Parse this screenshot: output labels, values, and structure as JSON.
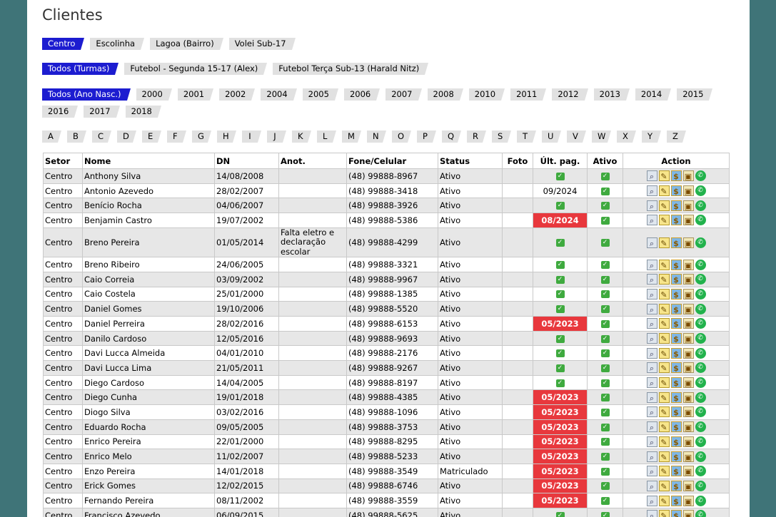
{
  "page_title": "Clientes",
  "setores": [
    {
      "label": "Centro",
      "active": true
    },
    {
      "label": "Escolinha",
      "active": false
    },
    {
      "label": "Lagoa (Bairro)",
      "active": false
    },
    {
      "label": "Volei Sub-17",
      "active": false
    }
  ],
  "turmas": [
    {
      "label": "Todos (Turmas)",
      "active": true
    },
    {
      "label": "Futebol - Segunda 15-17 (Alex)",
      "active": false
    },
    {
      "label": "Futebol Terça Sub-13 (Harald Nitz)",
      "active": false
    }
  ],
  "anos": [
    {
      "label": "Todos (Ano Nasc.)",
      "active": true
    },
    {
      "label": "2000"
    },
    {
      "label": "2001"
    },
    {
      "label": "2002"
    },
    {
      "label": "2004"
    },
    {
      "label": "2005"
    },
    {
      "label": "2006"
    },
    {
      "label": "2007"
    },
    {
      "label": "2008"
    },
    {
      "label": "2010"
    },
    {
      "label": "2011"
    },
    {
      "label": "2012"
    },
    {
      "label": "2013"
    },
    {
      "label": "2014"
    },
    {
      "label": "2015"
    },
    {
      "label": "2016"
    },
    {
      "label": "2017"
    },
    {
      "label": "2018"
    }
  ],
  "letters": [
    "A",
    "B",
    "C",
    "D",
    "E",
    "F",
    "G",
    "H",
    "I",
    "J",
    "K",
    "L",
    "M",
    "N",
    "O",
    "P",
    "Q",
    "R",
    "S",
    "T",
    "U",
    "V",
    "W",
    "X",
    "Y",
    "Z"
  ],
  "table": {
    "headers": [
      "Setor",
      "Nome",
      "DN",
      "Anot.",
      "Fone/Celular",
      "Status",
      "Foto",
      "Últ. pag.",
      "Ativo",
      "Action"
    ],
    "rows": [
      {
        "setor": "Centro",
        "nome": "Anthony Silva",
        "dn": "14/08/2008",
        "anot": "",
        "fone": "(48) 99888-8967",
        "status": "Ativo",
        "ult": "",
        "ult_due": false
      },
      {
        "setor": "Centro",
        "nome": "Antonio Azevedo",
        "dn": "28/02/2007",
        "anot": "",
        "fone": "(48) 99888-3418",
        "status": "Ativo",
        "ult": "09/2024",
        "ult_due": false
      },
      {
        "setor": "Centro",
        "nome": "Benício Rocha",
        "dn": "04/06/2007",
        "anot": "",
        "fone": "(48) 99888-3926",
        "status": "Ativo",
        "ult": "",
        "ult_due": false
      },
      {
        "setor": "Centro",
        "nome": "Benjamin Castro",
        "dn": "19/07/2002",
        "anot": "",
        "fone": "(48) 99888-5386",
        "status": "Ativo",
        "ult": "08/2024",
        "ult_due": true
      },
      {
        "setor": "Centro",
        "nome": "Breno Pereira",
        "dn": "01/05/2014",
        "anot": "Falta eletro e declaração escolar",
        "fone": "(48) 99888-4299",
        "status": "Ativo",
        "ult": "",
        "ult_due": false
      },
      {
        "setor": "Centro",
        "nome": "Breno Ribeiro",
        "dn": "24/06/2005",
        "anot": "",
        "fone": "(48) 99888-3321",
        "status": "Ativo",
        "ult": "",
        "ult_due": false
      },
      {
        "setor": "Centro",
        "nome": "Caio Correia",
        "dn": "03/09/2002",
        "anot": "",
        "fone": "(48) 99888-9967",
        "status": "Ativo",
        "ult": "",
        "ult_due": false
      },
      {
        "setor": "Centro",
        "nome": "Caio Costela",
        "dn": "25/01/2000",
        "anot": "",
        "fone": "(48) 99888-1385",
        "status": "Ativo",
        "ult": "",
        "ult_due": false
      },
      {
        "setor": "Centro",
        "nome": "Daniel Gomes",
        "dn": "19/10/2006",
        "anot": "",
        "fone": "(48) 99888-5520",
        "status": "Ativo",
        "ult": "",
        "ult_due": false
      },
      {
        "setor": "Centro",
        "nome": "Daniel Perreira",
        "dn": "28/02/2016",
        "anot": "",
        "fone": "(48) 99888-6153",
        "status": "Ativo",
        "ult": "05/2023",
        "ult_due": true
      },
      {
        "setor": "Centro",
        "nome": "Danilo Cardoso",
        "dn": "12/05/2016",
        "anot": "",
        "fone": "(48) 99888-9693",
        "status": "Ativo",
        "ult": "",
        "ult_due": false
      },
      {
        "setor": "Centro",
        "nome": "Davi Lucca Almeida",
        "dn": "04/01/2010",
        "anot": "",
        "fone": "(48) 99888-2176",
        "status": "Ativo",
        "ult": "",
        "ult_due": false
      },
      {
        "setor": "Centro",
        "nome": "Davi Lucca Lima",
        "dn": "21/05/2011",
        "anot": "",
        "fone": "(48) 99888-9267",
        "status": "Ativo",
        "ult": "",
        "ult_due": false
      },
      {
        "setor": "Centro",
        "nome": "Diego Cardoso",
        "dn": "14/04/2005",
        "anot": "",
        "fone": "(48) 99888-8197",
        "status": "Ativo",
        "ult": "",
        "ult_due": false
      },
      {
        "setor": "Centro",
        "nome": "Diego Cunha",
        "dn": "19/01/2018",
        "anot": "",
        "fone": "(48) 99888-4385",
        "status": "Ativo",
        "ult": "05/2023",
        "ult_due": true
      },
      {
        "setor": "Centro",
        "nome": "Diogo Silva",
        "dn": "03/02/2016",
        "anot": "",
        "fone": "(48) 99888-1096",
        "status": "Ativo",
        "ult": "05/2023",
        "ult_due": true
      },
      {
        "setor": "Centro",
        "nome": "Eduardo Rocha",
        "dn": "09/05/2005",
        "anot": "",
        "fone": "(48) 99888-3753",
        "status": "Ativo",
        "ult": "05/2023",
        "ult_due": true
      },
      {
        "setor": "Centro",
        "nome": "Enrico Pereira",
        "dn": "22/01/2000",
        "anot": "",
        "fone": "(48) 99888-8295",
        "status": "Ativo",
        "ult": "05/2023",
        "ult_due": true
      },
      {
        "setor": "Centro",
        "nome": "Enrico Melo",
        "dn": "11/02/2007",
        "anot": "",
        "fone": "(48) 99888-5233",
        "status": "Ativo",
        "ult": "05/2023",
        "ult_due": true
      },
      {
        "setor": "Centro",
        "nome": "Enzo Pereira",
        "dn": "14/01/2018",
        "anot": "",
        "fone": "(48) 99888-3549",
        "status": "Matriculado",
        "ult": "05/2023",
        "ult_due": true
      },
      {
        "setor": "Centro",
        "nome": "Erick Gomes",
        "dn": "12/02/2015",
        "anot": "",
        "fone": "(48) 99888-6746",
        "status": "Ativo",
        "ult": "05/2023",
        "ult_due": true
      },
      {
        "setor": "Centro",
        "nome": "Fernando Pereira",
        "dn": "08/11/2002",
        "anot": "",
        "fone": "(48) 99888-3559",
        "status": "Ativo",
        "ult": "05/2023",
        "ult_due": true
      },
      {
        "setor": "Centro",
        "nome": "Francisco Azevedo",
        "dn": "06/09/2015",
        "anot": "",
        "fone": "(48) 99888-5625",
        "status": "Ativo",
        "ult": "",
        "ult_due": false
      }
    ]
  },
  "colors": {
    "background": "#3f7478",
    "active_tab": "#1c1cd0",
    "due_red": "#e8383d",
    "check_green": "#3faa3f"
  },
  "icons": {
    "paid": "check-icon",
    "active": "check-icon",
    "actions": [
      "view-icon",
      "edit-icon",
      "payment-icon",
      "lock-icon",
      "whatsapp-icon"
    ]
  }
}
